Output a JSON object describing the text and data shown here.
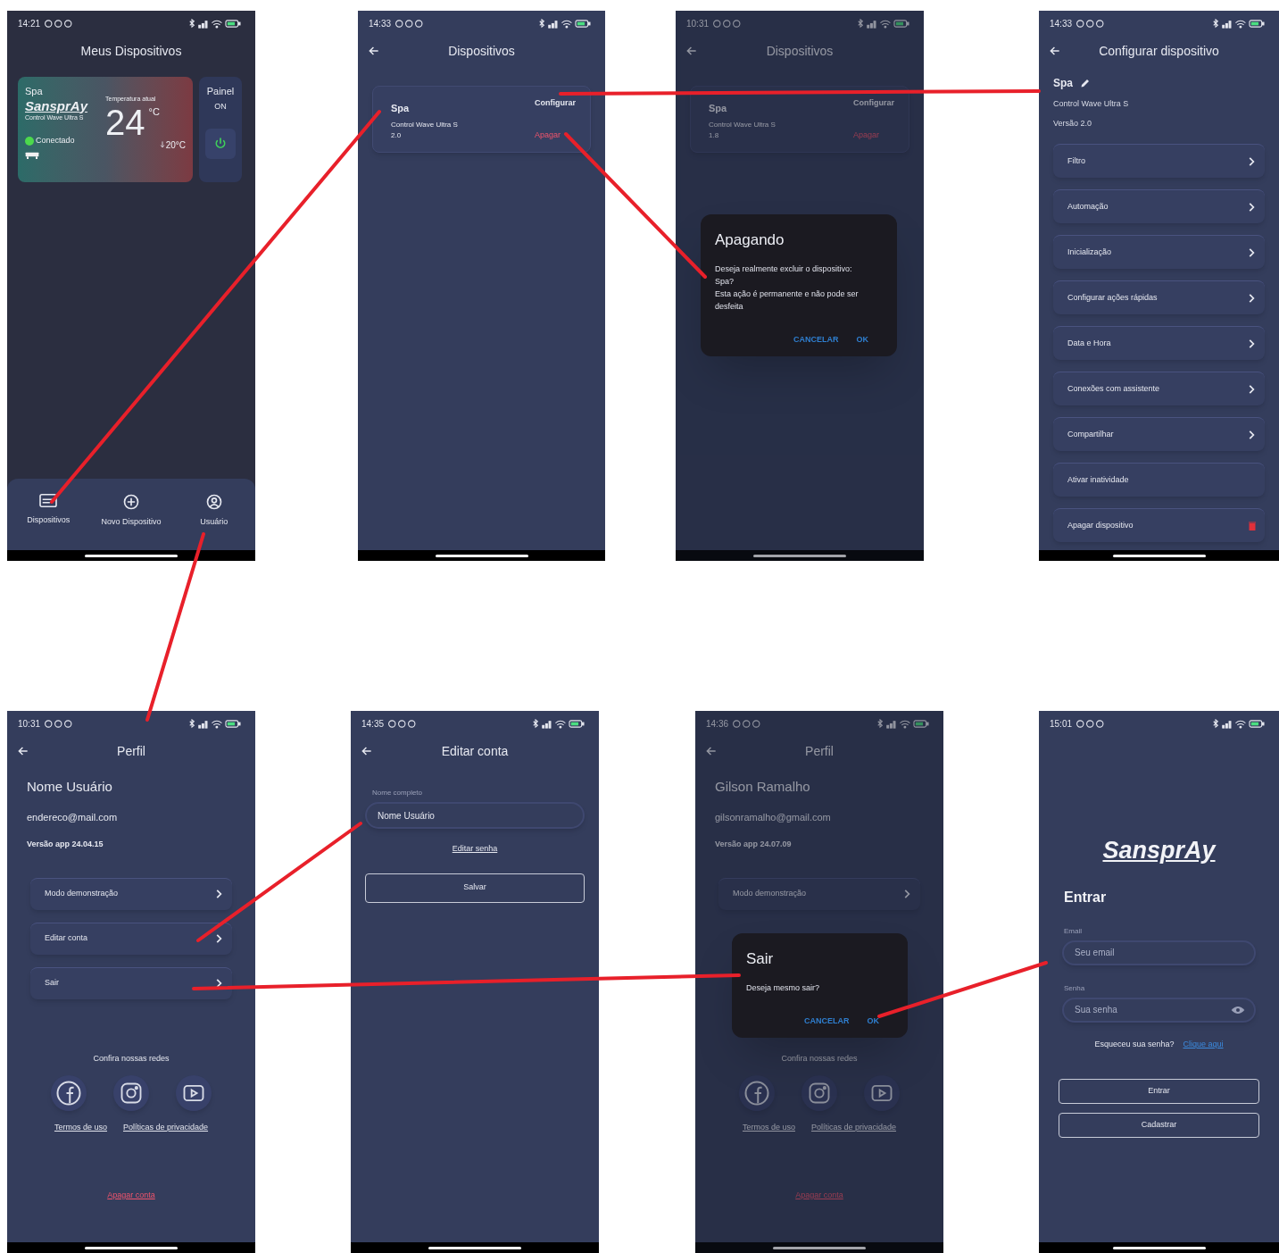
{
  "screens": [
    {
      "kind": "home",
      "time": "14:21",
      "title": "Meus Dispositivos",
      "device": {
        "name": "Spa",
        "brand": "SansprAy",
        "model": "Control Wave Ultra S",
        "temp_label": "Temperatura atual",
        "temp": "24",
        "temp_unit": "°C",
        "setpoint": "20°C",
        "status": "Conectado",
        "connected": true
      },
      "panel": {
        "label": "Painel",
        "state": "ON",
        "on": true
      },
      "nav": [
        {
          "label": "Dispositivos"
        },
        {
          "label": "Novo Dispositivo"
        },
        {
          "label": "Usuário"
        }
      ]
    },
    {
      "kind": "devices",
      "time": "14:33",
      "title": "Dispositivos",
      "device": {
        "name": "Spa",
        "model": "Control Wave Ultra S",
        "version": "2.0",
        "configure": "Configurar",
        "delete": "Apagar"
      }
    },
    {
      "kind": "devices",
      "time": "10:31",
      "title": "Dispositivos",
      "device": {
        "name": "Spa",
        "model": "Control Wave Ultra S",
        "version": "1.8",
        "configure": "Configurar",
        "delete": "Apagar"
      },
      "dialog": {
        "title": "Apagando",
        "lines": [
          "Deseja realmente excluir o dispositivo:",
          "Spa?",
          "Esta ação é permanente e não pode ser desfeita"
        ],
        "cancel": "CANCELAR",
        "ok": "OK"
      }
    },
    {
      "kind": "config",
      "time": "14:33",
      "title": "Configurar dispositivo",
      "name": "Spa",
      "model": "Control Wave Ultra S",
      "version": "Versão 2.0",
      "items": [
        {
          "label": "Filtro",
          "kind": "link"
        },
        {
          "label": "Automação",
          "kind": "link"
        },
        {
          "label": "Inicialização",
          "kind": "link"
        },
        {
          "label": "Configurar ações rápidas",
          "kind": "link"
        },
        {
          "label": "Data e Hora",
          "kind": "link"
        },
        {
          "label": "Conexões com assistente",
          "kind": "link"
        },
        {
          "label": "Compartilhar",
          "kind": "link"
        },
        {
          "label": "Ativar inatividade",
          "kind": "plain"
        },
        {
          "label": "Apagar dispositivo",
          "kind": "delete"
        }
      ]
    },
    {
      "kind": "profile",
      "time": "10:31",
      "title": "Perfil",
      "name": "Nome Usuário",
      "email": "endereco@mail.com",
      "version": "Versão app 24.04.15",
      "items": [
        "Modo demonstração",
        "Editar conta",
        "Sair"
      ],
      "social_label": "Confira nossas redes",
      "links": [
        "Termos de uso",
        "Políticas de privacidade"
      ],
      "delete": "Apagar conta"
    },
    {
      "kind": "edit",
      "time": "14:35",
      "title": "Editar conta",
      "field_label": "Nome completo",
      "value": "Nome Usuário",
      "password_link": "Editar senha",
      "save": "Salvar"
    },
    {
      "kind": "profile",
      "time": "14:36",
      "title": "Perfil",
      "name": "Gilson Ramalho",
      "email": "gilsonramalho@gmail.com",
      "version": "Versão app 24.07.09",
      "items": [
        "Modo demonstração"
      ],
      "social_label": "Confira nossas redes",
      "links": [
        "Termos de uso",
        "Políticas de privacidade"
      ],
      "delete": "Apagar conta",
      "dialog": {
        "title": "Sair",
        "lines": [
          "Deseja mesmo sair?"
        ],
        "cancel": "CANCELAR",
        "ok": "OK"
      }
    },
    {
      "kind": "login",
      "time": "15:01",
      "logo": "SansprAy",
      "title": "Entrar",
      "email_label": "Email",
      "email_placeholder": "Seu email",
      "password_label": "Senha",
      "password_placeholder": "Sua senha",
      "forgot": "Esqueceu sua senha?",
      "forgot_link": "Clique aqui",
      "login": "Entrar",
      "register": "Cadastrar"
    }
  ]
}
